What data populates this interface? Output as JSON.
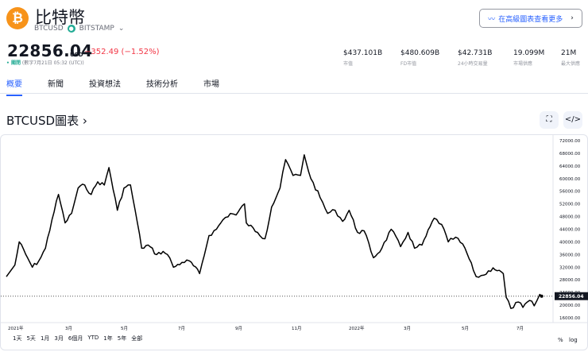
{
  "header": {
    "logo_glyph": "₿",
    "title": "比特幣",
    "symbol": "BTCUSD",
    "exchange": "BITSTAMP",
    "price": "22856.04",
    "currency": "USD",
    "change": "−352.49 (−1.52%)",
    "market_status": "關閉",
    "timestamp": "(數字7月21日 05:32 (UTC))",
    "advanced_chart_button": "在高級圖表查看更多"
  },
  "stats": [
    {
      "value": "$437.101B",
      "label": "市值"
    },
    {
      "value": "$480.609B",
      "label": "FD市值"
    },
    {
      "value": "$42.731B",
      "label": "24小時交易量"
    },
    {
      "value": "19.099M",
      "label": "市場供應"
    },
    {
      "value": "21M",
      "label": "最大供應"
    }
  ],
  "tabs": [
    "概要",
    "新聞",
    "投資想法",
    "技術分析",
    "市場"
  ],
  "chart_title": "BTCUSD圖表",
  "range_buttons": [
    "1天",
    "5天",
    "1月",
    "3月",
    "6個月",
    "YTD",
    "1年",
    "5年",
    "全部"
  ],
  "scale_buttons": {
    "percent": "%",
    "log": "log"
  },
  "colors": {
    "accent": "#2962ff",
    "down": "#f23645",
    "up": "#22ab94",
    "bitcoin": "#f7931a"
  },
  "chart_data": {
    "type": "line",
    "ylim": [
      16000,
      72000
    ],
    "y_ticks": [
      "72000.00",
      "68000.00",
      "64000.00",
      "60000.00",
      "56000.00",
      "52000.00",
      "48000.00",
      "44000.00",
      "40000.00",
      "36000.00",
      "32000.00",
      "28000.00",
      "24000.00",
      "20000.00",
      "16000.00"
    ],
    "x_ticks": [
      "2021年",
      "3月",
      "5月",
      "7月",
      "9月",
      "11月",
      "2022年",
      "3月",
      "5月",
      "7月"
    ],
    "last_price": 22856.04,
    "series": [
      [
        "2021-01-01",
        29000
      ],
      [
        "2021-01-08",
        40000
      ],
      [
        "2021-01-15",
        36000
      ],
      [
        "2021-01-22",
        32000
      ],
      [
        "2021-01-29",
        34000
      ],
      [
        "2021-02-05",
        38000
      ],
      [
        "2021-02-12",
        47000
      ],
      [
        "2021-02-19",
        55000
      ],
      [
        "2021-02-26",
        46000
      ],
      [
        "2021-03-05",
        49000
      ],
      [
        "2021-03-12",
        57000
      ],
      [
        "2021-03-19",
        58000
      ],
      [
        "2021-03-26",
        55000
      ],
      [
        "2021-04-02",
        59000
      ],
      [
        "2021-04-09",
        58000
      ],
      [
        "2021-04-14",
        63500
      ],
      [
        "2021-04-23",
        50000
      ],
      [
        "2021-04-30",
        57000
      ],
      [
        "2021-05-07",
        58000
      ],
      [
        "2021-05-12",
        50000
      ],
      [
        "2021-05-19",
        38000
      ],
      [
        "2021-05-26",
        39000
      ],
      [
        "2021-06-04",
        36000
      ],
      [
        "2021-06-11",
        37000
      ],
      [
        "2021-06-18",
        35000
      ],
      [
        "2021-06-22",
        32000
      ],
      [
        "2021-07-01",
        33500
      ],
      [
        "2021-07-09",
        34000
      ],
      [
        "2021-07-20",
        30000
      ],
      [
        "2021-07-30",
        42000
      ],
      [
        "2021-08-07",
        44000
      ],
      [
        "2021-08-14",
        47000
      ],
      [
        "2021-08-22",
        49000
      ],
      [
        "2021-08-28",
        48500
      ],
      [
        "2021-09-06",
        52000
      ],
      [
        "2021-09-08",
        46000
      ],
      [
        "2021-09-20",
        43000
      ],
      [
        "2021-09-28",
        41000
      ],
      [
        "2021-10-05",
        51000
      ],
      [
        "2021-10-14",
        57000
      ],
      [
        "2021-10-20",
        66000
      ],
      [
        "2021-10-28",
        61000
      ],
      [
        "2021-11-05",
        61000
      ],
      [
        "2021-11-09",
        67500
      ],
      [
        "2021-11-16",
        60000
      ],
      [
        "2021-11-26",
        54000
      ],
      [
        "2021-12-04",
        49000
      ],
      [
        "2021-12-12",
        50000
      ],
      [
        "2021-12-20",
        46500
      ],
      [
        "2021-12-27",
        50000
      ],
      [
        "2022-01-05",
        43000
      ],
      [
        "2022-01-12",
        43500
      ],
      [
        "2022-01-22",
        35000
      ],
      [
        "2022-01-31",
        38000
      ],
      [
        "2022-02-10",
        44000
      ],
      [
        "2022-02-20",
        38500
      ],
      [
        "2022-02-28",
        43000
      ],
      [
        "2022-03-07",
        38000
      ],
      [
        "2022-03-15",
        39000
      ],
      [
        "2022-03-28",
        47500
      ],
      [
        "2022-04-05",
        45500
      ],
      [
        "2022-04-12",
        40000
      ],
      [
        "2022-04-20",
        41500
      ],
      [
        "2022-04-30",
        38000
      ],
      [
        "2022-05-09",
        31000
      ],
      [
        "2022-05-12",
        29000
      ],
      [
        "2022-05-20",
        29500
      ],
      [
        "2022-05-30",
        31800
      ],
      [
        "2022-06-10",
        30000
      ],
      [
        "2022-06-13",
        22500
      ],
      [
        "2022-06-18",
        19000
      ],
      [
        "2022-06-26",
        21000
      ],
      [
        "2022-07-01",
        19300
      ],
      [
        "2022-07-08",
        21500
      ],
      [
        "2022-07-13",
        19800
      ],
      [
        "2022-07-19",
        23400
      ],
      [
        "2022-07-21",
        22856.04
      ]
    ]
  }
}
